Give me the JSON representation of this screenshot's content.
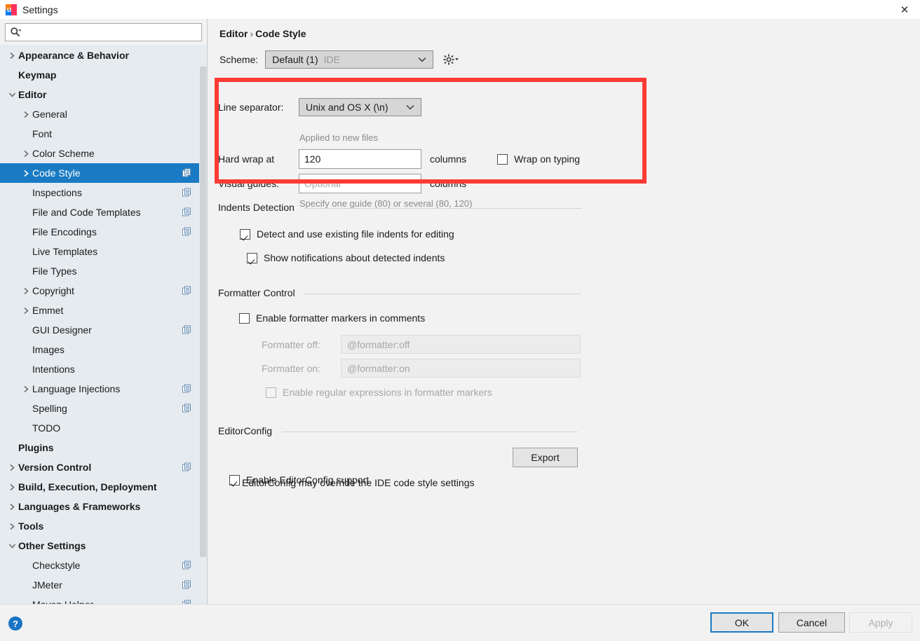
{
  "window": {
    "title": "Settings",
    "app_icon": "intellij-idea-icon",
    "close_label": "✕"
  },
  "search": {
    "placeholder": "",
    "value": "",
    "icon": "search-icon"
  },
  "sidebar": {
    "items": [
      {
        "label": "Appearance & Behavior",
        "indent": 0,
        "bold": true,
        "chevron": "right",
        "badge": false,
        "selected": false
      },
      {
        "label": "Keymap",
        "indent": 0,
        "bold": true,
        "chevron": "none",
        "badge": false,
        "selected": false
      },
      {
        "label": "Editor",
        "indent": 0,
        "bold": true,
        "chevron": "down",
        "badge": false,
        "selected": false
      },
      {
        "label": "General",
        "indent": 1,
        "bold": false,
        "chevron": "right",
        "badge": false,
        "selected": false
      },
      {
        "label": "Font",
        "indent": 1,
        "bold": false,
        "chevron": "none",
        "badge": false,
        "selected": false
      },
      {
        "label": "Color Scheme",
        "indent": 1,
        "bold": false,
        "chevron": "right",
        "badge": false,
        "selected": false
      },
      {
        "label": "Code Style",
        "indent": 1,
        "bold": false,
        "chevron": "right",
        "badge": true,
        "selected": true
      },
      {
        "label": "Inspections",
        "indent": 1,
        "bold": false,
        "chevron": "none",
        "badge": true,
        "selected": false
      },
      {
        "label": "File and Code Templates",
        "indent": 1,
        "bold": false,
        "chevron": "none",
        "badge": true,
        "selected": false
      },
      {
        "label": "File Encodings",
        "indent": 1,
        "bold": false,
        "chevron": "none",
        "badge": true,
        "selected": false
      },
      {
        "label": "Live Templates",
        "indent": 1,
        "bold": false,
        "chevron": "none",
        "badge": false,
        "selected": false
      },
      {
        "label": "File Types",
        "indent": 1,
        "bold": false,
        "chevron": "none",
        "badge": false,
        "selected": false
      },
      {
        "label": "Copyright",
        "indent": 1,
        "bold": false,
        "chevron": "right",
        "badge": true,
        "selected": false
      },
      {
        "label": "Emmet",
        "indent": 1,
        "bold": false,
        "chevron": "right",
        "badge": false,
        "selected": false
      },
      {
        "label": "GUI Designer",
        "indent": 1,
        "bold": false,
        "chevron": "none",
        "badge": true,
        "selected": false
      },
      {
        "label": "Images",
        "indent": 1,
        "bold": false,
        "chevron": "none",
        "badge": false,
        "selected": false
      },
      {
        "label": "Intentions",
        "indent": 1,
        "bold": false,
        "chevron": "none",
        "badge": false,
        "selected": false
      },
      {
        "label": "Language Injections",
        "indent": 1,
        "bold": false,
        "chevron": "right",
        "badge": true,
        "selected": false
      },
      {
        "label": "Spelling",
        "indent": 1,
        "bold": false,
        "chevron": "none",
        "badge": true,
        "selected": false
      },
      {
        "label": "TODO",
        "indent": 1,
        "bold": false,
        "chevron": "none",
        "badge": false,
        "selected": false
      },
      {
        "label": "Plugins",
        "indent": 0,
        "bold": true,
        "chevron": "none",
        "badge": false,
        "selected": false
      },
      {
        "label": "Version Control",
        "indent": 0,
        "bold": true,
        "chevron": "right",
        "badge": true,
        "selected": false
      },
      {
        "label": "Build, Execution, Deployment",
        "indent": 0,
        "bold": true,
        "chevron": "right",
        "badge": false,
        "selected": false
      },
      {
        "label": "Languages & Frameworks",
        "indent": 0,
        "bold": true,
        "chevron": "right",
        "badge": false,
        "selected": false
      },
      {
        "label": "Tools",
        "indent": 0,
        "bold": true,
        "chevron": "right",
        "badge": false,
        "selected": false
      },
      {
        "label": "Other Settings",
        "indent": 0,
        "bold": true,
        "chevron": "down",
        "badge": false,
        "selected": false
      },
      {
        "label": "Checkstyle",
        "indent": 1,
        "bold": false,
        "chevron": "none",
        "badge": true,
        "selected": false
      },
      {
        "label": "JMeter",
        "indent": 1,
        "bold": false,
        "chevron": "none",
        "badge": true,
        "selected": false
      },
      {
        "label": "Maven Helper",
        "indent": 1,
        "bold": false,
        "chevron": "none",
        "badge": true,
        "selected": false
      }
    ]
  },
  "content": {
    "breadcrumb": {
      "parent": "Editor",
      "separator": "›",
      "current": "Code Style"
    },
    "scheme": {
      "label": "Scheme:",
      "value": "Default (1)",
      "scope": "IDE",
      "gear_icon": "gear-icon"
    },
    "line_separator": {
      "label": "Line separator:",
      "value": "Unix and OS X (\\n)",
      "hint": "Applied to new files"
    },
    "hard_wrap": {
      "label": "Hard wrap at",
      "value": "120",
      "units": "columns"
    },
    "wrap_on_typing": {
      "label": "Wrap on typing",
      "checked": false
    },
    "visual_guides": {
      "label": "Visual guides:",
      "value": "",
      "placeholder": "Optional",
      "units": "columns",
      "hint": "Specify one guide (80) or several (80, 120)"
    },
    "indents_detection": {
      "title": "Indents Detection",
      "detect": {
        "label": "Detect and use existing file indents for editing",
        "checked": true
      },
      "notify": {
        "label": "Show notifications about detected indents",
        "checked": true
      }
    },
    "formatter_control": {
      "title": "Formatter Control",
      "enable": {
        "label": "Enable formatter markers in comments",
        "checked": false
      },
      "off_label": "Formatter off:",
      "off_value": "@formatter:off",
      "on_label": "Formatter on:",
      "on_value": "@formatter:on",
      "regex": {
        "label": "Enable regular expressions in formatter markers",
        "checked": false
      }
    },
    "editorconfig": {
      "title": "EditorConfig",
      "enable": {
        "label": "Enable EditorConfig support",
        "checked": true
      },
      "export_label": "Export",
      "note": "EditorConfig may override the IDE code style settings"
    }
  },
  "footer": {
    "help_icon": "help-icon",
    "ok_label": "OK",
    "cancel_label": "Cancel",
    "apply_label": "Apply"
  },
  "colors": {
    "selection": "#1a7bc4",
    "highlight_box": "#fb3b34",
    "sidebar_bg": "#e6ebef",
    "panel_bg": "#f2f2f2"
  }
}
